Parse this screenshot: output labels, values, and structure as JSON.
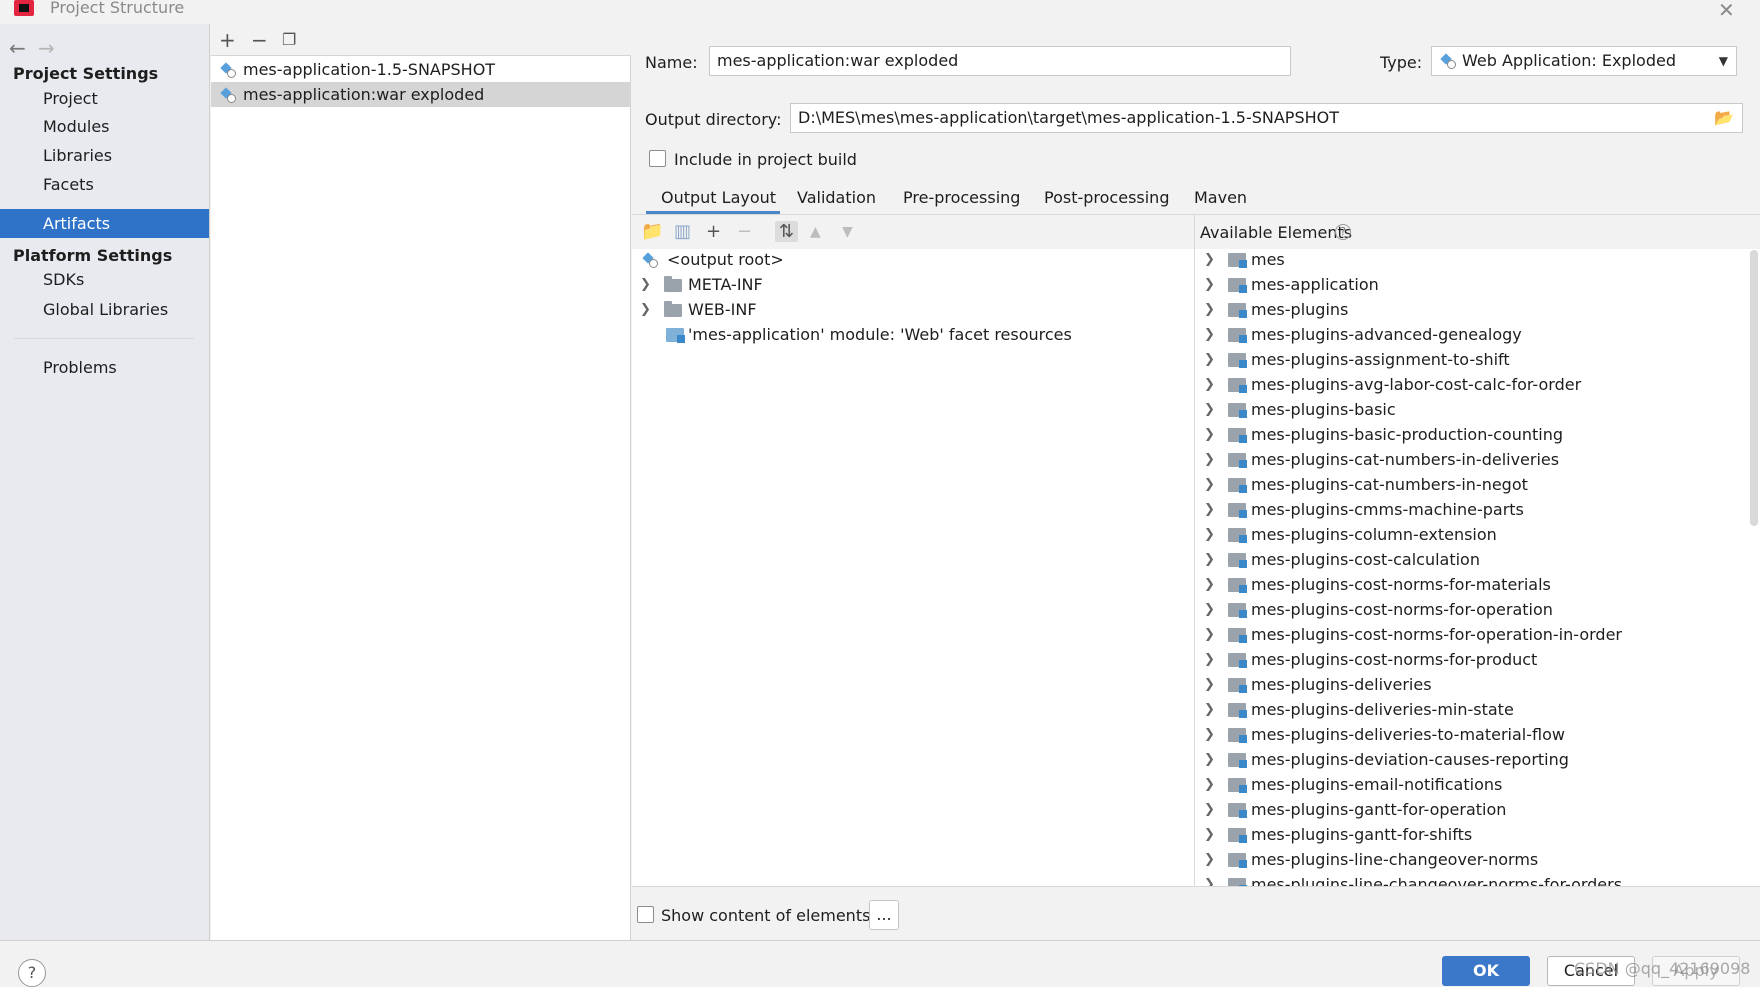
{
  "window": {
    "title": "Project Structure",
    "close_icon": "close-icon"
  },
  "nav": {
    "project_settings_heading": "Project Settings",
    "project_items": [
      "Project",
      "Modules",
      "Libraries",
      "Facets",
      "Artifacts"
    ],
    "platform_settings_heading": "Platform Settings",
    "platform_items": [
      "SDKs",
      "Global Libraries"
    ],
    "problems": "Problems",
    "selected": "Artifacts"
  },
  "artifacts": {
    "items": [
      "mes-application-1.5-SNAPSHOT",
      "mes-application:war exploded"
    ],
    "selected_index": 1
  },
  "form": {
    "name_label": "Name:",
    "name_value": "mes-application:war exploded",
    "type_label": "Type:",
    "type_value": "Web Application: Exploded",
    "output_dir_label": "Output directory:",
    "output_dir_value": "D:\\MES\\mes\\mes-application\\target\\mes-application-1.5-SNAPSHOT",
    "include_build_label": "Include in project build",
    "include_build_checked": false
  },
  "tabs": [
    "Output Layout",
    "Validation",
    "Pre-processing",
    "Post-processing",
    "Maven"
  ],
  "active_tab": "Output Layout",
  "output_tree": {
    "root": "<output root>",
    "children": [
      "META-INF",
      "WEB-INF"
    ],
    "facet_resources": "'mes-application' module: 'Web' facet resources"
  },
  "available": {
    "header": "Available Elements",
    "items": [
      "mes",
      "mes-application",
      "mes-plugins",
      "mes-plugins-advanced-genealogy",
      "mes-plugins-assignment-to-shift",
      "mes-plugins-avg-labor-cost-calc-for-order",
      "mes-plugins-basic",
      "mes-plugins-basic-production-counting",
      "mes-plugins-cat-numbers-in-deliveries",
      "mes-plugins-cat-numbers-in-negot",
      "mes-plugins-cmms-machine-parts",
      "mes-plugins-column-extension",
      "mes-plugins-cost-calculation",
      "mes-plugins-cost-norms-for-materials",
      "mes-plugins-cost-norms-for-operation",
      "mes-plugins-cost-norms-for-operation-in-order",
      "mes-plugins-cost-norms-for-product",
      "mes-plugins-deliveries",
      "mes-plugins-deliveries-min-state",
      "mes-plugins-deliveries-to-material-flow",
      "mes-plugins-deviation-causes-reporting",
      "mes-plugins-email-notifications",
      "mes-plugins-gantt-for-operation",
      "mes-plugins-gantt-for-shifts",
      "mes-plugins-line-changeover-norms",
      "mes-plugins-line-changeover-norms-for-orders"
    ]
  },
  "bottom": {
    "show_content_label": "Show content of elements",
    "more_button": "..."
  },
  "footer": {
    "ok": "OK",
    "cancel": "Cancel",
    "apply": "Apply",
    "help": "?",
    "watermark": "CSDN @qq_42169098"
  },
  "colors": {
    "selection": "#2f73c8",
    "ok_button": "#3b78c9",
    "module_badge": "#3b88c8"
  }
}
